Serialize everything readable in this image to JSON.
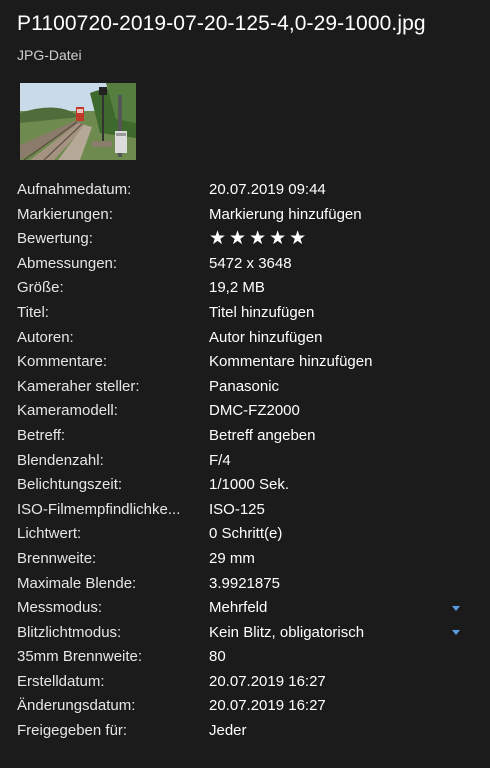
{
  "file": {
    "name": "P1100720-2019-07-20-125-4,0-29-1000.jpg",
    "type": "JPG-Datei",
    "thumbnail_icon": "photo-thumbnail"
  },
  "properties": [
    {
      "label": "Aufnahmedatum:",
      "value": "20.07.2019 09:44",
      "editable": false
    },
    {
      "label": "Markierungen:",
      "value": "Markierung hinzufügen",
      "editable": true
    },
    {
      "label": "Bewertung:",
      "value": "★★★★★",
      "editable": true,
      "rating": 0,
      "rating_max": 5
    },
    {
      "label": "Abmessungen:",
      "value": "5472 x 3648",
      "editable": false
    },
    {
      "label": "Größe:",
      "value": "19,2 MB",
      "editable": false
    },
    {
      "label": "Titel:",
      "value": "Titel hinzufügen",
      "editable": true
    },
    {
      "label": "Autoren:",
      "value": "Autor hinzufügen",
      "editable": true
    },
    {
      "label": "Kommentare:",
      "value": "Kommentare hinzufügen",
      "editable": true
    },
    {
      "label": "Kameraher steller:",
      "value": "Panasonic",
      "editable": true
    },
    {
      "label": "Kameramodell:",
      "value": "DMC-FZ2000",
      "editable": true
    },
    {
      "label": "Betreff:",
      "value": "Betreff angeben",
      "editable": true
    },
    {
      "label": "Blendenzahl:",
      "value": "F/4",
      "editable": false
    },
    {
      "label": "Belichtungszeit:",
      "value": "1/1000 Sek.",
      "editable": false
    },
    {
      "label": "ISO-Filmempfindlichke...",
      "value": "ISO-125",
      "editable": false
    },
    {
      "label": "Lichtwert:",
      "value": "0 Schritt(e)",
      "editable": false
    },
    {
      "label": "Brennweite:",
      "value": "29 mm",
      "editable": false
    },
    {
      "label": "Maximale Blende:",
      "value": "3.9921875",
      "editable": false
    },
    {
      "label": "Messmodus:",
      "value": "Mehrfeld",
      "editable": true,
      "dropdown": true
    },
    {
      "label": "Blitzlichtmodus:",
      "value": "Kein Blitz, obligatorisch",
      "editable": true,
      "dropdown": true
    },
    {
      "label": "35mm Brennweite:",
      "value": "80",
      "editable": false
    },
    {
      "label": "Erstelldatum:",
      "value": "20.07.2019 16:27",
      "editable": false
    },
    {
      "label": "Änderungsdatum:",
      "value": "20.07.2019 16:27",
      "editable": false
    },
    {
      "label": "Freigegeben für:",
      "value": "Jeder",
      "editable": false
    }
  ],
  "colors": {
    "background": "#1b1b1b",
    "accent": "#5b9ce6"
  }
}
